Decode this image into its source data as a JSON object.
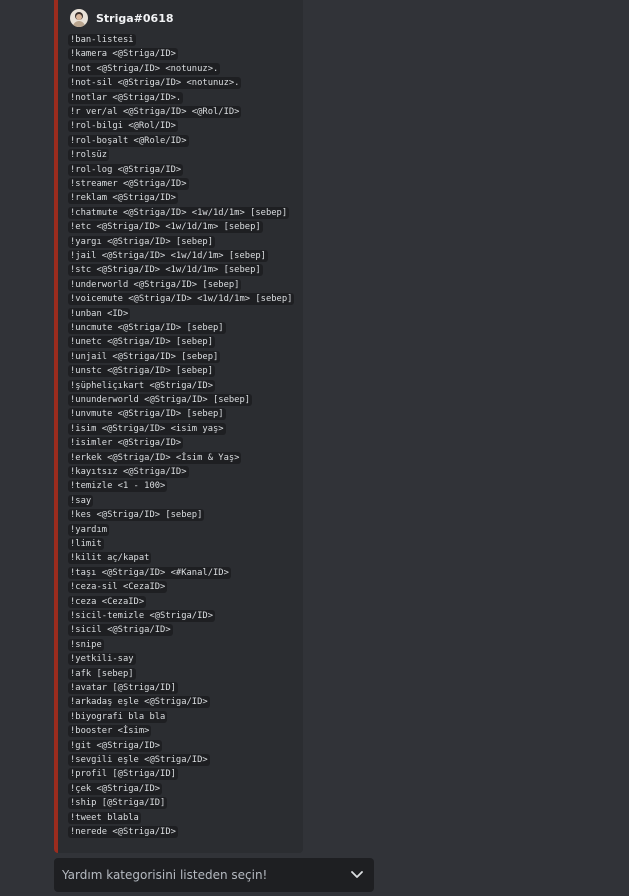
{
  "message": {
    "author": "Striga#0618",
    "commands": [
      "!ban-listesi",
      "!kamera <@Striga/ID>",
      "!not <@Striga/ID> <notunuz>.",
      "!not-sil <@Striga/ID> <notunuz>.",
      "!notlar <@Striga/ID>.",
      "!r ver/al <@Striga/ID> <@Rol/ID>",
      "!rol-bilgi <@Rol/ID>",
      "!rol-boşalt <@Role/ID>",
      "!rolsüz",
      "!rol-log <@Striga/ID>",
      "!streamer <@Striga/ID>",
      "!reklam <@Striga/ID>",
      "!chatmute <@Striga/ID> <1w/1d/1m> [sebep]",
      "!etc <@Striga/ID> <1w/1d/1m> [sebep]",
      "!yargı <@Striga/ID> [sebep]",
      "!jail <@Striga/ID> <1w/1d/1m> [sebep]",
      "!stc <@Striga/ID> <1w/1d/1m> [sebep]",
      "!underworld <@Striga/ID> [sebep]",
      "!voicemute <@Striga/ID> <1w/1d/1m> [sebep]",
      "!unban <ID>",
      "!uncmute <@Striga/ID> [sebep]",
      "!unetc <@Striga/ID> [sebep]",
      "!unjail <@Striga/ID> [sebep]",
      "!unstc <@Striga/ID> [sebep]",
      "!şüpheliçıkart <@Striga/ID>",
      "!ununderworld <@Striga/ID> [sebep]",
      "!unvmute <@Striga/ID> [sebep]",
      "!isim <@Striga/ID> <isim yaş>",
      "!isimler <@Striga/ID>",
      "!erkek <@Striga/ID> <İsim & Yaş>",
      "!kayıtsız <@Striga/ID>",
      "!temizle <1 - 100>",
      "!say",
      "!kes <@Striga/ID> [sebep]",
      "!yardım",
      "!limit",
      "!kilit aç/kapat",
      "!taşı <@Striga/ID> <#Kanal/ID>",
      "!ceza-sil <CezaID>",
      "!ceza <CezaID>",
      "!sicil-temizle <@Striga/ID>",
      "!sicil <@Striga/ID>",
      "!snipe",
      "!yetkili-say",
      "!afk [sebep]",
      "!avatar [@Striga/ID]",
      "!arkadaş eşle <@Striga/ID>",
      "!biyografi bla bla",
      "!booster <İsim>",
      "!git <@Striga/ID>",
      "!sevgili eşle <@Striga/ID>",
      "!profil [@Striga/ID]",
      "!çek <@Striga/ID>",
      "!ship [@Striga/ID]",
      "!tweet blabla",
      "!nerede <@Striga/ID>"
    ]
  },
  "select_menu": {
    "placeholder": "Yardım kategorisini listeden seçin!"
  },
  "colors": {
    "embed_border": "#9b2c1e",
    "background": "#313338"
  }
}
